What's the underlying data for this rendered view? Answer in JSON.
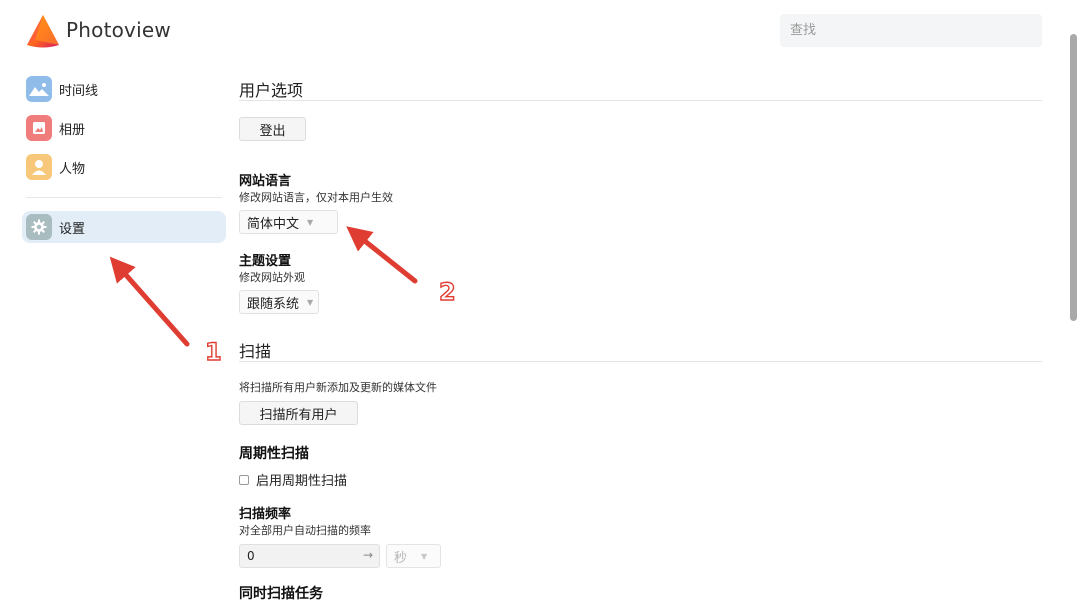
{
  "app": {
    "title": "Photoview"
  },
  "search": {
    "placeholder": "查找"
  },
  "sidebar": {
    "items": [
      {
        "label": "时间线",
        "icon": "timeline-photo-icon",
        "color": "#8fbce8"
      },
      {
        "label": "相册",
        "icon": "album-icon",
        "color": "#f07c7c"
      },
      {
        "label": "人物",
        "icon": "person-icon",
        "color": "#f7c879"
      },
      {
        "label": "设置",
        "icon": "gear-icon",
        "color": "#a9bcbf",
        "active": true
      }
    ]
  },
  "user_options": {
    "title": "用户选项",
    "logout_label": "登出",
    "language": {
      "title": "网站语言",
      "description": "修改网站语言，仅对本用户生效",
      "value": "简体中文"
    },
    "theme": {
      "title": "主题设置",
      "description": "修改网站外观",
      "value": "跟随系统"
    }
  },
  "scan": {
    "title": "扫描",
    "description": "将扫描所有用户新添加及更新的媒体文件",
    "scan_all_label": "扫描所有用户",
    "periodic": {
      "title": "周期性扫描",
      "checkbox_label": "启用周期性扫描",
      "checked": false
    },
    "frequency": {
      "title": "扫描频率",
      "description": "对全部用户自动扫描的频率",
      "value": "0",
      "unit": "秒"
    },
    "concurrent": {
      "title": "同时扫描任务"
    }
  },
  "annotations": {
    "first": "1",
    "second": "2",
    "color": "#e03d32"
  }
}
